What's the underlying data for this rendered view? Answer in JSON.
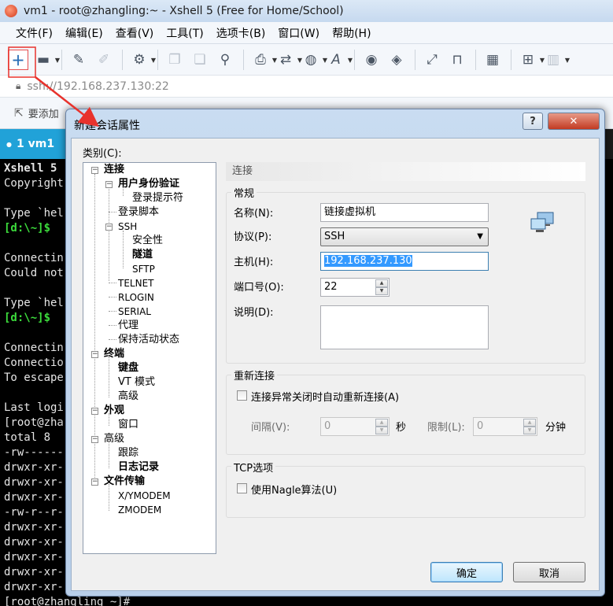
{
  "window": {
    "title": "vm1 - root@zhangling:~ - Xshell 5 (Free for Home/School)"
  },
  "menu": [
    "文件(F)",
    "编辑(E)",
    "查看(V)",
    "工具(T)",
    "选项卡(B)",
    "窗口(W)",
    "帮助(H)"
  ],
  "address": "ssh://192.168.237.130:22",
  "hint": "要添加",
  "tab": {
    "label": "1 vm1"
  },
  "terminal_lines": [
    "Xshell 5",
    "Copyright",
    "",
    "Type `hel",
    "[d:\\~]$",
    "",
    "Connectin",
    "Could not",
    "",
    "Type `hel",
    "[d:\\~]$",
    "",
    "Connectin",
    "Connectio",
    "To escape",
    "",
    "Last logi",
    "[root@zha",
    "total 8",
    "-rw------",
    "drwxr-xr-",
    "drwxr-xr-",
    "drwxr-xr-",
    "-rw-r--r-",
    "drwxr-xr-",
    "drwxr-xr-",
    "drwxr-xr-",
    "drwxr-xr-",
    "drwxr-xr-",
    "[root@zhangling ~]# "
  ],
  "dialog": {
    "title": "新建会话属性",
    "category_label": "类别(C):",
    "tree": [
      "连接",
      "用户身份验证",
      "登录提示符",
      "登录脚本",
      "SSH",
      "安全性",
      "隧道",
      "SFTP",
      "TELNET",
      "RLOGIN",
      "SERIAL",
      "代理",
      "保持活动状态",
      "终端",
      "键盘",
      "VT 模式",
      "高级",
      "外观",
      "窗口",
      "高级",
      "跟踪",
      "日志记录",
      "文件传输",
      "X/YMODEM",
      "ZMODEM"
    ],
    "panel_title": "连接",
    "general_group": "常规",
    "name_label": "名称(N):",
    "name_value": "链接虚拟机",
    "protocol_label": "协议(P):",
    "protocol_value": "SSH",
    "host_label": "主机(H):",
    "host_value": "192.168.237.130",
    "port_label": "端口号(O):",
    "port_value": "22",
    "desc_label": "说明(D):",
    "reconnect_group": "重新连接",
    "reconnect_checkbox": "连接异常关闭时自动重新连接(A)",
    "interval_label": "间隔(V):",
    "interval_value": "0",
    "seconds_unit": "秒",
    "limit_label": "限制(L):",
    "limit_value": "0",
    "minutes_unit": "分钟",
    "tcp_group": "TCP选项",
    "nagle_checkbox": "使用Nagle算法(U)",
    "ok_button": "确定",
    "cancel_button": "取消"
  }
}
